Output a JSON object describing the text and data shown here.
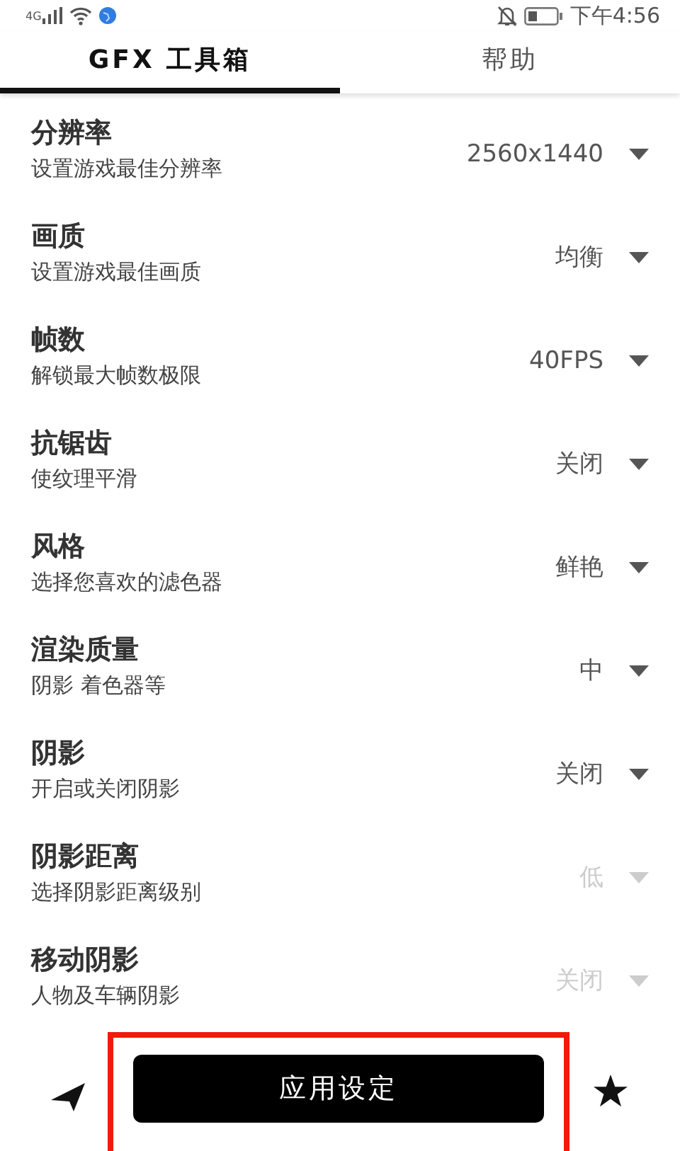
{
  "status_bar": {
    "network": "4G",
    "time": "下午4:56"
  },
  "tabs": [
    {
      "label": "GFX 工具箱",
      "selected": true
    },
    {
      "label": "帮助",
      "selected": false
    }
  ],
  "settings": [
    {
      "title": "分辨率",
      "subtitle": "设置游戏最佳分辨率",
      "value": "2560x1440",
      "disabled": false
    },
    {
      "title": "画质",
      "subtitle": "设置游戏最佳画质",
      "value": "均衡",
      "disabled": false
    },
    {
      "title": "帧数",
      "subtitle": "解锁最大帧数极限",
      "value": "40FPS",
      "disabled": false
    },
    {
      "title": "抗锯齿",
      "subtitle": "使纹理平滑",
      "value": "关闭",
      "disabled": false
    },
    {
      "title": "风格",
      "subtitle": "选择您喜欢的滤色器",
      "value": "鲜艳",
      "disabled": false
    },
    {
      "title": "渲染质量",
      "subtitle": "阴影 着色器等",
      "value": "中",
      "disabled": false
    },
    {
      "title": "阴影",
      "subtitle": "开启或关闭阴影",
      "value": "关闭",
      "disabled": false
    },
    {
      "title": "阴影距离",
      "subtitle": "选择阴影距离级别",
      "value": "低",
      "disabled": true
    },
    {
      "title": "移动阴影",
      "subtitle": "人物及车辆阴影",
      "value": "关闭",
      "disabled": true
    }
  ],
  "apply_button": {
    "label": "应用设定"
  }
}
